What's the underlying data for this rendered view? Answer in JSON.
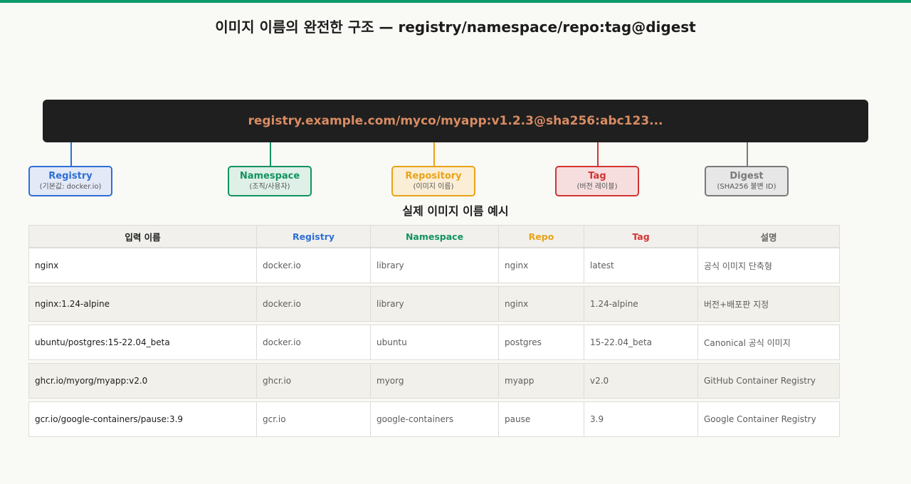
{
  "title": "이미지 이름의 완전한 구조 — registry/namespace/repo:tag@digest",
  "full_name": "registry.example.com/myco/myapp:v1.2.3@sha256:abc123...",
  "components": [
    {
      "label": "Registry",
      "sub": "(기본값: docker.io)",
      "color": "#2f6fd6",
      "bg": "#e3e9f7"
    },
    {
      "label": "Namespace",
      "sub": "(조직/사용자)",
      "color": "#12935f",
      "bg": "#dff0e8"
    },
    {
      "label": "Repository",
      "sub": "(이미지 이름)",
      "color": "#e8a317",
      "bg": "#fbeed6"
    },
    {
      "label": "Tag",
      "sub": "(버전 레이블)",
      "color": "#d23434",
      "bg": "#f7dede"
    },
    {
      "label": "Digest",
      "sub": "(SHA256 불변 ID)",
      "color": "#7a7a7a",
      "bg": "#e7e7e7"
    }
  ],
  "table_title": "실제 이미지 이름 예시",
  "table": {
    "headers": [
      {
        "label": "입력 이름",
        "color": "#1c1c1c"
      },
      {
        "label": "Registry",
        "color": "#2f6fd6"
      },
      {
        "label": "Namespace",
        "color": "#12935f"
      },
      {
        "label": "Repo",
        "color": "#e8a317"
      },
      {
        "label": "Tag",
        "color": "#d23434"
      },
      {
        "label": "설명",
        "color": "#666666"
      }
    ],
    "rows": [
      [
        "nginx",
        "docker.io",
        "library",
        "nginx",
        "latest",
        "공식 이미지 단축형"
      ],
      [
        "nginx:1.24-alpine",
        "docker.io",
        "library",
        "nginx",
        "1.24-alpine",
        "버전+배포판 지정"
      ],
      [
        "ubuntu/postgres:15-22.04_beta",
        "docker.io",
        "ubuntu",
        "postgres",
        "15-22.04_beta",
        "Canonical 공식 이미지"
      ],
      [
        "ghcr.io/myorg/myapp:v2.0",
        "ghcr.io",
        "myorg",
        "myapp",
        "v2.0",
        "GitHub Container Registry"
      ],
      [
        "gcr.io/google-containers/pause:3.9",
        "gcr.io",
        "google-containers",
        "pause",
        "3.9",
        "Google Container Registry"
      ]
    ]
  }
}
